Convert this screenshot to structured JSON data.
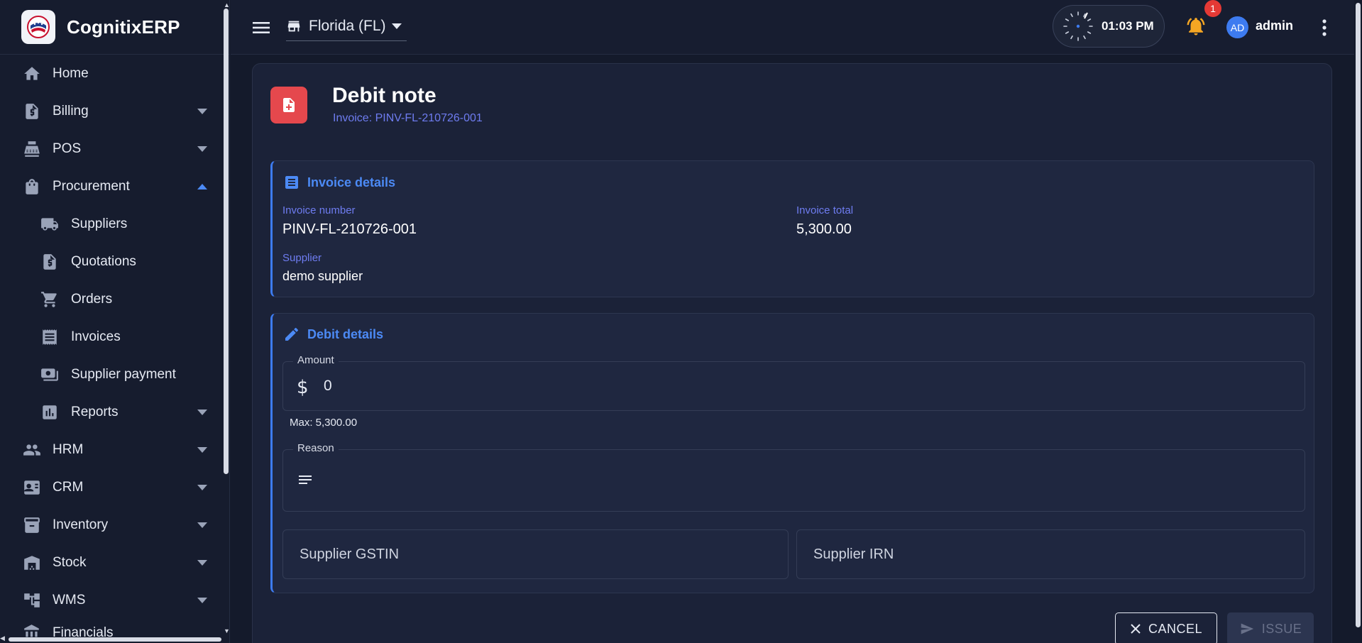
{
  "app": {
    "name": "CognitixERP"
  },
  "sidebar": {
    "items": [
      {
        "label": "Home",
        "icon": "home-icon"
      },
      {
        "label": "Billing",
        "icon": "billing-icon"
      },
      {
        "label": "POS",
        "icon": "pos-icon"
      },
      {
        "label": "Procurement",
        "icon": "procurement-icon",
        "expanded": true
      },
      {
        "label": "Suppliers",
        "icon": "truck-icon"
      },
      {
        "label": "Quotations",
        "icon": "quotation-icon"
      },
      {
        "label": "Orders",
        "icon": "cart-icon"
      },
      {
        "label": "Invoices",
        "icon": "receipt-icon"
      },
      {
        "label": "Supplier payment",
        "icon": "payment-icon"
      },
      {
        "label": "Reports",
        "icon": "reports-icon"
      },
      {
        "label": "HRM",
        "icon": "people-icon"
      },
      {
        "label": "CRM",
        "icon": "contact-card-icon"
      },
      {
        "label": "Inventory",
        "icon": "archive-icon"
      },
      {
        "label": "Stock",
        "icon": "warehouse-icon"
      },
      {
        "label": "WMS",
        "icon": "hierarchy-icon"
      },
      {
        "label": "Financials",
        "icon": "bank-icon"
      }
    ]
  },
  "topbar": {
    "store": "Florida (FL)",
    "time": "01:03 PM",
    "notifications_count": "1",
    "avatar_initials": "AD",
    "username": "admin"
  },
  "page": {
    "title": "Debit note",
    "subtitle": "Invoice: PINV-FL-210726-001"
  },
  "invoice_details": {
    "heading": "Invoice details",
    "invoice_number_label": "Invoice number",
    "invoice_number": "PINV-FL-210726-001",
    "invoice_total_label": "Invoice total",
    "invoice_total": "5,300.00",
    "supplier_label": "Supplier",
    "supplier": "demo supplier"
  },
  "debit_details": {
    "heading": "Debit details",
    "amount_label": "Amount",
    "amount_value": "0",
    "amount_helper": "Max: 5,300.00",
    "reason_label": "Reason",
    "gstin_placeholder": "Supplier GSTIN",
    "irn_placeholder": "Supplier IRN"
  },
  "actions": {
    "cancel": "CANCEL",
    "issue": "ISSUE"
  },
  "colors": {
    "accent": "#3d7bf0",
    "danger": "#e5484d",
    "warning": "#f5a623",
    "background": "#141a2b"
  }
}
